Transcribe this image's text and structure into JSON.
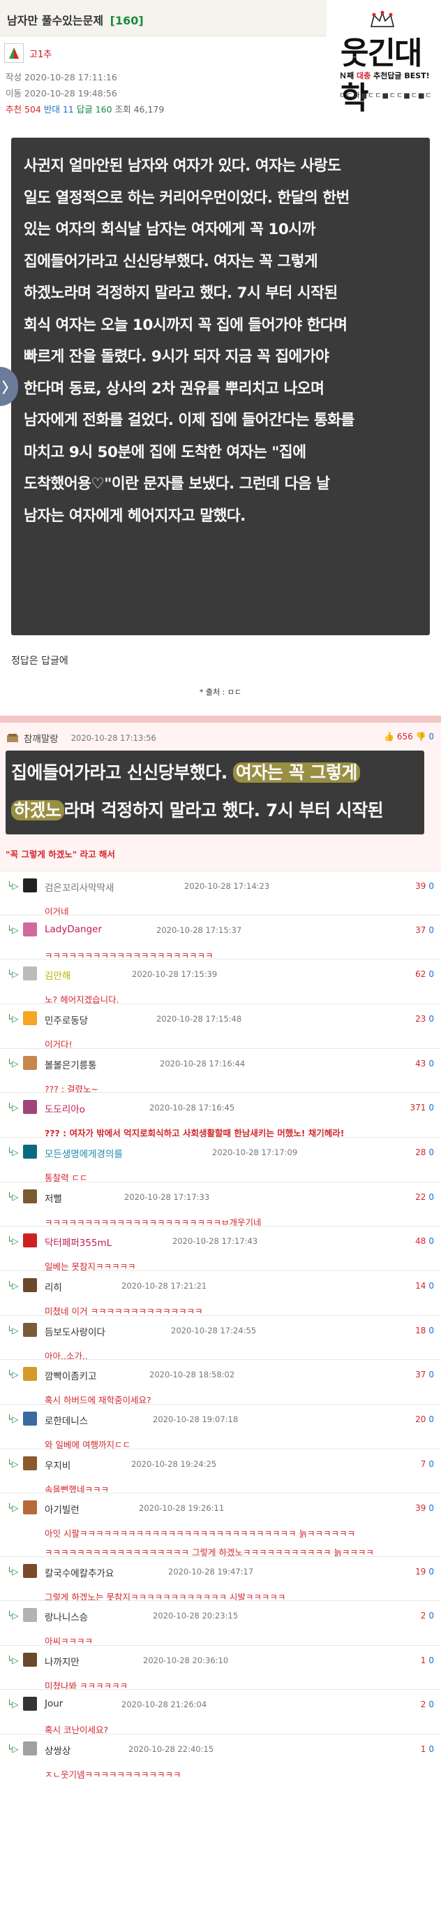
{
  "post": {
    "title": "남자만 풀수있는문제",
    "comment_count_label": "[160]",
    "author": "고1추",
    "written_label": "작성",
    "written_time": "2020-10-28 17:11:16",
    "moved_label": "이동",
    "moved_time": "2020-10-28 19:48:56",
    "recommend_label": "추천",
    "recommend": "504",
    "oppose_label": "반대",
    "oppose": "11",
    "reply_label": "답글",
    "replies": "160",
    "views_label": "조회",
    "views": "46,179",
    "image_text": "사귄지 얼마안된 남자와 여자가 있다. 여자는 사랑도\n일도 열정적으로 하는 커리어우먼이었다. 한달의 한번\n있는 여자의 회식날 남자는 여자에게 꼭 10시까\n집에들어가라고 신신당부했다. 여자는 꼭 그렇게\n하겠노라며 걱정하지 말라고 했다. 7시 부터 시작된\n회식 여자는 오늘 10시까지 꼭 집에 들어가야 한다며\n빠르게 잔을 돌렸다. 9시가 되자 지금 꼭 집에가야\n한다며 동료, 상사의 2차 권유를 뿌리치고 나오며\n남자에게 전화를 걸었다. 이제 집에 들어간다는 통화를\n마치고 9시 50분에 집에 도착한 여자는 \"집에\n도착했어용♡\"이란 문자를 보냈다. 그런데 다음 날\n남자는 여자에게 헤어지자고 말했다.",
    "answer_note": "정답은 답글에",
    "source": "* 출처 : ㅁㄷ",
    "side_arrow": "〉"
  },
  "logo": {
    "tiny_text": "웃대로고",
    "main": "웃긴대학",
    "sub_prefix": "Ｎ째 ",
    "sub_red": "대충",
    "sub_suffix": " 추천답글 BEST!",
    "sub2": "ㄷㄷ퐈■ㄷㄷ■ㄷㄷ■ㄷ■ㄷ"
  },
  "best_comment": {
    "name": "참깨말랑",
    "time": "2020-10-28 17:13:56",
    "up": "656",
    "down": "0",
    "img_l1_a": "집에들어가라고 신신당부했다. ",
    "img_l1_hl": "여자는 꼭 그렇게",
    "img_l2_hl": "하겠노",
    "img_l2_b": "라며 걱정하지 말라고 했다. 7시 부터 시작된",
    "quote": "\"꼭 그렇게 하겠노\" 라고 해서"
  },
  "reply_marker": "└▷",
  "comments": [
    {
      "name": "검은꼬리사막딱새",
      "time": "2020-10-28 17:14:23",
      "up": "39",
      "down": "0",
      "body": "이거네",
      "color": "#777"
    },
    {
      "name": "LadyDanger",
      "time": "2020-10-28 17:15:37",
      "up": "37",
      "down": "0",
      "body": "ㅋㅋㅋㅋㅋㅋㅋㅋㅋㅋㅋㅋㅋㅋㅋㅋㅋㅋㅋㅋㅋ",
      "color": "#c2185b"
    },
    {
      "name": "김만해",
      "time": "2020-10-28 17:15:39",
      "up": "62",
      "down": "0",
      "body": "노? 헤어지겠습니다.",
      "color": "#b7b300"
    },
    {
      "name": "민주로동당",
      "time": "2020-10-28 17:15:48",
      "up": "23",
      "down": "0",
      "body": "이거다!",
      "color": "#333"
    },
    {
      "name": "볼볼은기릉통",
      "time": "2020-10-28 17:16:44",
      "up": "43",
      "down": "0",
      "body": "??? : 걸렸노~",
      "color": "#333"
    },
    {
      "name": "도도리아o",
      "time": "2020-10-28 17:16:45",
      "up": "371",
      "down": "0",
      "body": "??? : 여자가 밖에서 억지로회식하고 사회생활할때 한남새키는 머했노! 채기헤라!",
      "color": "#c2185b",
      "bold": true
    },
    {
      "name": "모든생명에게경의를",
      "time": "2020-10-28 17:17:09",
      "up": "28",
      "down": "0",
      "body": "통찰력 ㄷㄷ",
      "color": "#1e88a8"
    },
    {
      "name": "저뻘",
      "time": "2020-10-28 17:17:33",
      "up": "22",
      "down": "0",
      "body": "ㅋㅋㅋㅋㅋㅋㅋㅋㅋㅋㅋㅋㅋㅋㅋㅋㅋㅋㅋㅋㅋㅋㅂ개웃기네",
      "color": "#333"
    },
    {
      "name": "닥터페퍼355mL",
      "time": "2020-10-28 17:17:43",
      "up": "48",
      "down": "0",
      "body": "일베는 못참지ㅋㅋㅋㅋㅋ",
      "color": "#c2185b"
    },
    {
      "name": "리히",
      "time": "2020-10-28 17:21:21",
      "up": "14",
      "down": "0",
      "body": "미쳤네 이거 ㅋㅋㅋㅋㅋㅋㅋㅋㅋㅋㅋㅋㅋㅋ",
      "color": "#333"
    },
    {
      "name": "듬보도사랑이다",
      "time": "2020-10-28 17:24:55",
      "up": "18",
      "down": "0",
      "body": "아아..소가..",
      "color": "#333"
    },
    {
      "name": "깜빡이좀키고",
      "time": "2020-10-28 18:58:02",
      "up": "37",
      "down": "0",
      "body": "혹시 하버드에 재학중이세요?",
      "color": "#333"
    },
    {
      "name": "로한데니스",
      "time": "2020-10-28 19:07:18",
      "up": "20",
      "down": "0",
      "body": "와 일베에 여행까지ㄷㄷ",
      "color": "#333"
    },
    {
      "name": "우지비",
      "time": "2020-10-28 19:24:25",
      "up": "7",
      "down": "0",
      "body": "속을뻔했네ㅋㅋㅋ",
      "color": "#333"
    },
    {
      "name": "아기빌런",
      "time": "2020-10-28 19:26:11",
      "up": "39",
      "down": "0",
      "body": "아잇 시팔ㅋㅋㅋㅋㅋㅋㅋㅋㅋㅋㅋㅋㅋㅋㅋㅋㅋㅋㅋㅋㅋㅋㅋㅋㅋㅋㅋ 늙ㅋㅋㅋㅋㅋㅋ",
      "body2": "ㅋㅋㅋㅋㅋㅋㅋㅋㅋㅋㅋㅋㅋㅋㅋㅋㅋㅋ 그렇게 하겠노ㅋㅋㅋㅋㅋㅋㅋㅋㅋㅋㅋ 늙ㅋㅋㅋㅋ",
      "color": "#333"
    },
    {
      "name": "칼국수에칼추가요",
      "time": "2020-10-28 19:47:17",
      "up": "19",
      "down": "0",
      "body": "그렇게 하겠노는 못참지ㅋㅋㅋㅋㅋㅋㅋㅋㅋㅋㅋㅋ 시발ㅋㅋㅋㅋㅋ",
      "color": "#333"
    },
    {
      "name": "랑나니스승",
      "time": "2020-10-28 20:23:15",
      "up": "2",
      "down": "0",
      "body": "아씨ㅋㅋㅋㅋ",
      "color": "#333"
    },
    {
      "name": "나까지만",
      "time": "2020-10-28 20:36:10",
      "up": "1",
      "down": "0",
      "body": "미쳤나봐 ㅋㅋㅋㅋㅋㅋ",
      "color": "#333"
    },
    {
      "name": "Jour",
      "time": "2020-10-28 21:26:04",
      "up": "2",
      "down": "0",
      "body": "혹시 코난이세요?",
      "color": "#333"
    },
    {
      "name": "상쌍상",
      "time": "2020-10-28 22:40:15",
      "up": "1",
      "down": "0",
      "body": "ㅈㄴ웃기넴ㅋㅋㅋㅋㅋㅋㅋㅋㅋㅋㅋㅋ",
      "color": "#333"
    }
  ]
}
